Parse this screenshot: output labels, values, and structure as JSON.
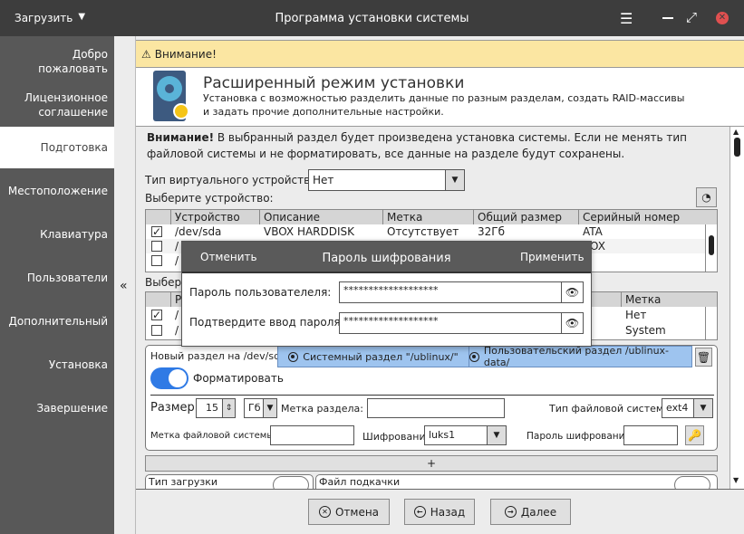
{
  "titlebar": {
    "menu_label": "Загрузить",
    "title": "Программа установки системы"
  },
  "sidebar": {
    "items": [
      {
        "label": "Добро пожаловать"
      },
      {
        "label": "Лицензионное соглашение"
      },
      {
        "label": "Подготовка",
        "selected": true
      },
      {
        "label": "Местоположение"
      },
      {
        "label": "Клавиатура"
      },
      {
        "label": "Пользователи"
      },
      {
        "label": "Дополнительный"
      },
      {
        "label": "Установка"
      },
      {
        "label": "Завершение"
      }
    ],
    "collapse_label": "«"
  },
  "warning_bar": {
    "text": "Внимание!"
  },
  "header": {
    "title": "Расширенный режим установки",
    "description": "Установка с возможностью разделить данные по разным разделам, создать RAID-массивы и задать прочие дополнительные настройки."
  },
  "content": {
    "notice_bold": "Внимание!",
    "notice_text": " В выбранный раздел будет произведена установка системы. Если не менять тип файловой системы и не форматировать, все данные на разделе будут сохранены.",
    "virtual_device_label": "Тип виртуального устройства:",
    "virtual_device_value": "Нет",
    "select_device_label": "Выберите устройство:",
    "devices": {
      "columns": [
        "Устройство",
        "Описание",
        "Метка",
        "Общий размер",
        "Серийный номер"
      ],
      "rows": [
        {
          "checked": true,
          "cells": [
            "/dev/sda",
            "VBOX HARDDISK",
            "Отсутствует",
            "32Гб",
            "ATA"
          ]
        },
        {
          "checked": false,
          "cells": [
            "/",
            "",
            "",
            "",
            "BOX"
          ]
        },
        {
          "checked": false,
          "cells": [
            "/",
            "",
            "",
            "",
            ""
          ]
        }
      ]
    },
    "select_partition_label": "Выбери",
    "partitions": {
      "columns": [
        "Ра",
        "Метка"
      ],
      "rows": [
        {
          "checked": true,
          "cells": [
            "/",
            "Нет"
          ]
        },
        {
          "checked": false,
          "cells": [
            "/",
            "System"
          ]
        }
      ]
    },
    "new_partition": {
      "tab_label": "Новый раздел на /dev/sda",
      "system_tab": "Системный раздел \"/ublinux/\"",
      "user_tab": "Пользовательский раздел /ublinux-data/",
      "format_label": "Форматировать",
      "format_on": true,
      "size_label": "Размер:",
      "size_value": "15",
      "unit_value": "Гб",
      "partition_label_label": "Метка раздела:",
      "partition_label_value": "",
      "fs_type_label": "Тип файловой системы:",
      "fs_type_value": "ext4",
      "fs_label_label": "Метка файловой системы:",
      "fs_label_value": "",
      "encryption_label": "Шифрование:",
      "encryption_value": "luks1",
      "enc_password_label": "Пароль шифрования",
      "enc_password_value": ""
    },
    "add_label": "+",
    "boot_type_label": "Тип загрузки",
    "swap_file_label": "Файл подкачки"
  },
  "dialog": {
    "cancel": "Отменить",
    "title": "Пароль шифрования",
    "apply": "Применить",
    "password_label": "Пароль пользователеля:",
    "password_value": "*******************",
    "confirm_label": "Подтвердите ввод пароля:",
    "confirm_value": "*******************"
  },
  "footer": {
    "cancel": "Отмена",
    "back": "Назад",
    "next": "Далее"
  }
}
